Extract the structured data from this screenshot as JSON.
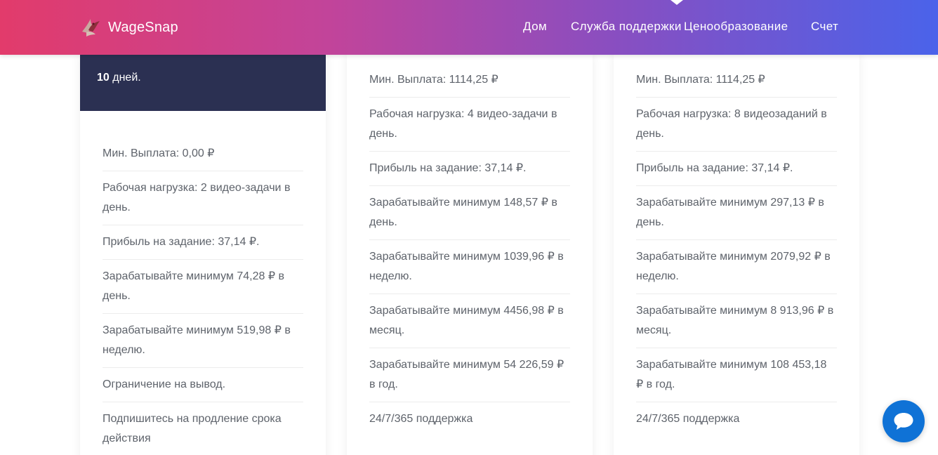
{
  "brand": {
    "name": "WageSnap",
    "logo_icon": "bird-logo-icon"
  },
  "nav": {
    "items": [
      "Дом",
      "Служба поддержки",
      "Ценообразование",
      "Счет"
    ]
  },
  "plans": [
    {
      "header_bold": "10",
      "header_rest": " дней.",
      "features": [
        "Мин. Выплата: 0,00 ₽",
        "Рабочая нагрузка: 2 видео-задачи в день.",
        "Прибыль на задание: 37,14 ₽.",
        "Зарабатывайте минимум 74,28 ₽ в день.",
        "Зарабатывайте минимум 519,98 ₽ в неделю.",
        "Ограничение на вывод.",
        "Подпишитесь на продление срока действия"
      ]
    },
    {
      "features": [
        "Мин. Выплата: 1114,25 ₽",
        "Рабочая нагрузка: 4 видео-задачи в день.",
        "Прибыль на задание: 37,14 ₽.",
        "Зарабатывайте минимум 148,57 ₽ в день.",
        "Зарабатывайте минимум 1039,96 ₽ в неделю.",
        "Зарабатывайте минимум 4456,98 ₽ в месяц.",
        "Зарабатывайте минимум 54 226,59 ₽ в год.",
        "24/7/365 поддержка"
      ]
    },
    {
      "features": [
        "Мин. Выплата: 1114,25 ₽",
        "Рабочая нагрузка: 8 видеозаданий в день.",
        "Прибыль на задание: 37,14 ₽.",
        "Зарабатывайте минимум 297,13 ₽ в день.",
        "Зарабатывайте минимум 2079,92 ₽ в неделю.",
        "Зарабатывайте минимум 8 913,96 ₽ в месяц.",
        "Зарабатывайте минимум 108 453,18 ₽ в год.",
        "24/7/365 поддержка"
      ]
    }
  ],
  "chat": {
    "icon": "chat-bubble-icon"
  },
  "colors": {
    "header_gradient_start": "#e23b6b",
    "header_gradient_end": "#4a63ea",
    "plan_header_bg": "#2b3052",
    "chat_button": "#0f72d6"
  }
}
